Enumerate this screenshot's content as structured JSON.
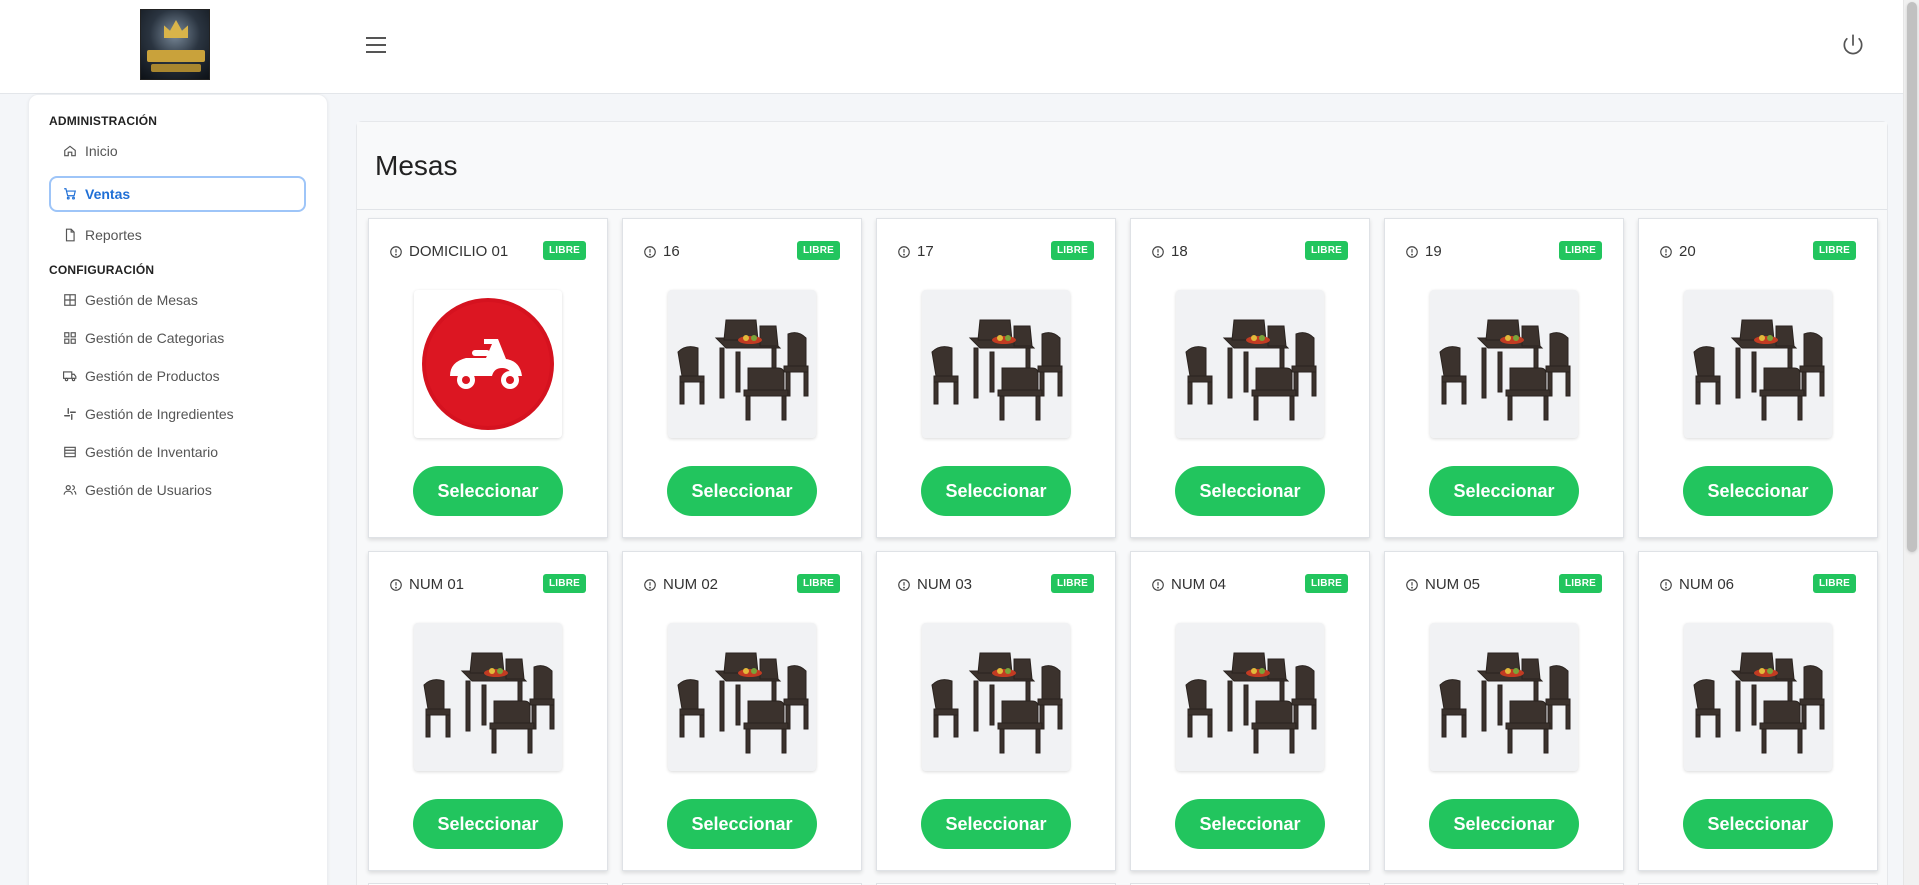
{
  "header": {
    "logo_icon": "restaurant-logo",
    "menu_icon": "hamburger-icon",
    "logout_icon": "power-icon"
  },
  "sidebar": {
    "sections": [
      {
        "title": "ADMINISTRACIÓN",
        "items": [
          {
            "label": "Inicio",
            "icon": "home-icon",
            "active": false
          },
          {
            "label": "Ventas",
            "icon": "cart-icon",
            "active": true
          },
          {
            "label": "Reportes",
            "icon": "file-icon",
            "active": false
          }
        ]
      },
      {
        "title": "CONFIGURACIÓN",
        "items": [
          {
            "label": "Gestión de Mesas",
            "icon": "table-icon",
            "active": false
          },
          {
            "label": "Gestión de Categorias",
            "icon": "grid-icon",
            "active": false
          },
          {
            "label": "Gestión de Productos",
            "icon": "truck-icon",
            "active": false
          },
          {
            "label": "Gestión de Ingredientes",
            "icon": "slack-icon",
            "active": false
          },
          {
            "label": "Gestión de Inventario",
            "icon": "list-icon",
            "active": false
          },
          {
            "label": "Gestión de Usuarios",
            "icon": "users-icon",
            "active": false
          }
        ]
      }
    ]
  },
  "main": {
    "title": "Mesas",
    "colors": {
      "accent": "#22c55e",
      "active_nav": "#1f6fd6"
    },
    "tables": [
      {
        "name": "DOMICILIO 01",
        "status": "LIBRE",
        "image": "scooter",
        "button": "Seleccionar"
      },
      {
        "name": "16",
        "status": "LIBRE",
        "image": "dining-set",
        "button": "Seleccionar"
      },
      {
        "name": "17",
        "status": "LIBRE",
        "image": "dining-set",
        "button": "Seleccionar"
      },
      {
        "name": "18",
        "status": "LIBRE",
        "image": "dining-set",
        "button": "Seleccionar"
      },
      {
        "name": "19",
        "status": "LIBRE",
        "image": "dining-set",
        "button": "Seleccionar"
      },
      {
        "name": "20",
        "status": "LIBRE",
        "image": "dining-set",
        "button": "Seleccionar"
      },
      {
        "name": "NUM 01",
        "status": "LIBRE",
        "image": "dining-set",
        "button": "Seleccionar"
      },
      {
        "name": "NUM 02",
        "status": "LIBRE",
        "image": "dining-set",
        "button": "Seleccionar"
      },
      {
        "name": "NUM 03",
        "status": "LIBRE",
        "image": "dining-set",
        "button": "Seleccionar"
      },
      {
        "name": "NUM 04",
        "status": "LIBRE",
        "image": "dining-set",
        "button": "Seleccionar"
      },
      {
        "name": "NUM 05",
        "status": "LIBRE",
        "image": "dining-set",
        "button": "Seleccionar"
      },
      {
        "name": "NUM 06",
        "status": "LIBRE",
        "image": "dining-set",
        "button": "Seleccionar"
      }
    ]
  }
}
